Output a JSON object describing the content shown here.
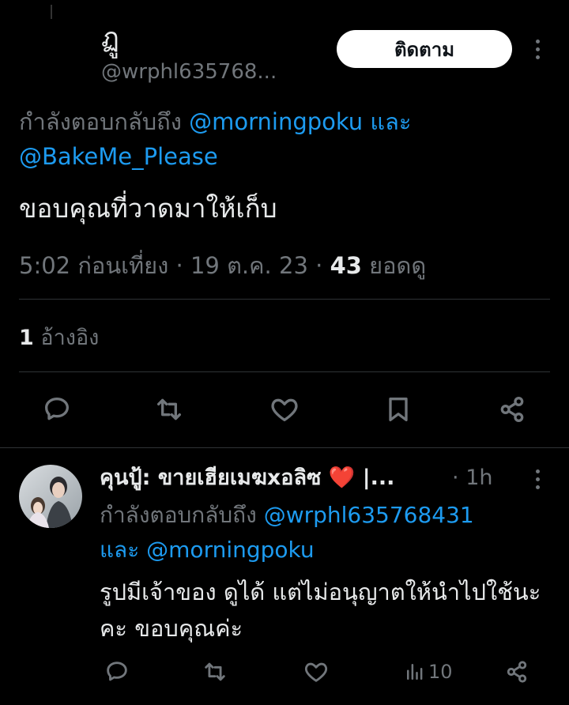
{
  "tweet": {
    "display_name": "ฏู",
    "handle": "@wrphl635768...",
    "follow_label": "ติดตาม",
    "reply_prefix": "กำลังตอบกลับถึง",
    "mention_1": "@morningpoku",
    "conj": "และ",
    "mention_2": "@BakeMe_Please",
    "text": "ขอบคุณที่วาดมาให้เก็บ",
    "time": "5:02 ก่อนเที่ยง",
    "date": "19 ต.ค. 23",
    "views_count": "43",
    "views_label": "ยอดดู",
    "quotes_count": "1",
    "quotes_label": "อ้างอิง",
    "actions": [
      "reply-icon",
      "retweet-icon",
      "like-icon",
      "bookmark-icon",
      "share-icon"
    ]
  },
  "reply": {
    "display_name": "คุนปู้: ขายเฮียเมฆxอลิซ ❤️ |...",
    "time_sep": "·",
    "time": "1h",
    "reply_prefix": "กำลังตอบกลับถึง",
    "mention_1": "@wrphl635768431",
    "conj": "และ",
    "mention_2": "@morningpoku",
    "text": "รูปมีเจ้าของ ดูได้ แต่ไม่อนุญาตให้นำไปใช้นะคะ ขอบคุณค่ะ",
    "views": "10",
    "actions": [
      "reply-icon",
      "retweet-icon",
      "like-icon",
      "views-icon",
      "share-icon"
    ]
  },
  "colors": {
    "accent": "#1d9bf0",
    "muted": "#71767b",
    "text": "#e7e9ea",
    "divider": "#2f3336"
  }
}
